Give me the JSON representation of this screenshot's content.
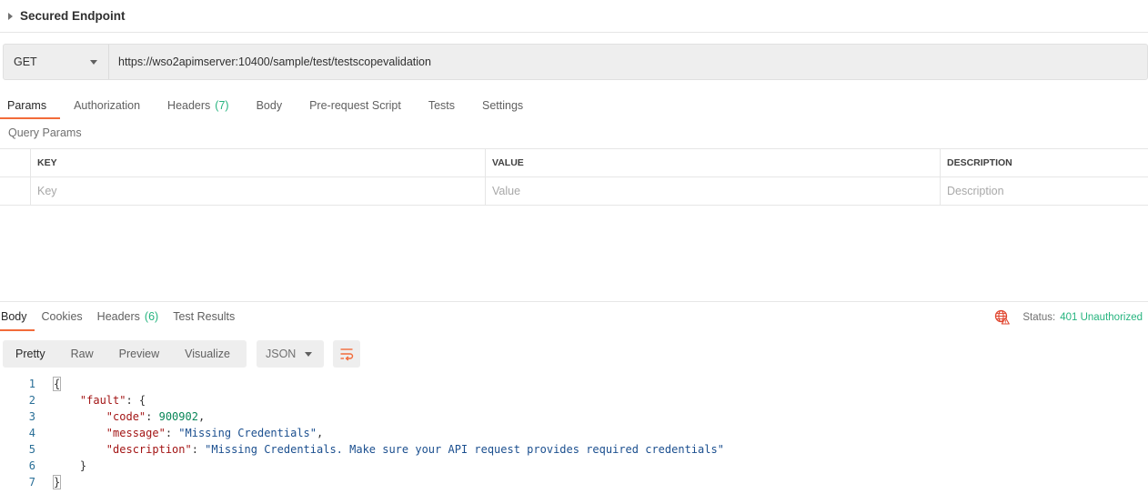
{
  "request": {
    "name": "Secured Endpoint",
    "method": "GET",
    "url": "https://wso2apimserver:10400/sample/test/testscopevalidation"
  },
  "request_tabs": [
    {
      "label": "Params",
      "count": "",
      "active": true
    },
    {
      "label": "Authorization",
      "count": ""
    },
    {
      "label": "Headers",
      "count": "(7)"
    },
    {
      "label": "Body",
      "count": ""
    },
    {
      "label": "Pre-request Script",
      "count": ""
    },
    {
      "label": "Tests",
      "count": ""
    },
    {
      "label": "Settings",
      "count": ""
    }
  ],
  "query_params": {
    "section_label": "Query Params",
    "columns": [
      "KEY",
      "VALUE",
      "DESCRIPTION"
    ],
    "placeholders": {
      "key": "Key",
      "value": "Value",
      "description": "Description"
    }
  },
  "response_tabs": [
    {
      "label": "Body",
      "count": "",
      "active": true
    },
    {
      "label": "Cookies",
      "count": ""
    },
    {
      "label": "Headers",
      "count": "(6)"
    },
    {
      "label": "Test Results",
      "count": ""
    }
  ],
  "status": {
    "label": "Status:",
    "value": "401 Unauthorized",
    "icon": "globe-error-icon",
    "color": "#26b47f"
  },
  "view_modes": [
    "Pretty",
    "Raw",
    "Preview",
    "Visualize"
  ],
  "format": "JSON",
  "body_lines": {
    "numbers": [
      "1",
      "2",
      "3",
      "4",
      "5",
      "6",
      "7"
    ],
    "open_brace": "{",
    "fault_key": "\"fault\"",
    "code_key": "\"code\"",
    "code_value": "900902",
    "message_key": "\"message\"",
    "message_value": "\"Missing Credentials\"",
    "description_key": "\"description\"",
    "description_value": "\"Missing Credentials. Make sure your API request provides required credentials\"",
    "close_inner": "}",
    "close_outer": "}"
  },
  "colors": {
    "accent": "#f26b3a",
    "success": "#26b47f",
    "json_key": "#a31515",
    "json_string": "#1b4f8f",
    "json_number": "#098658"
  }
}
